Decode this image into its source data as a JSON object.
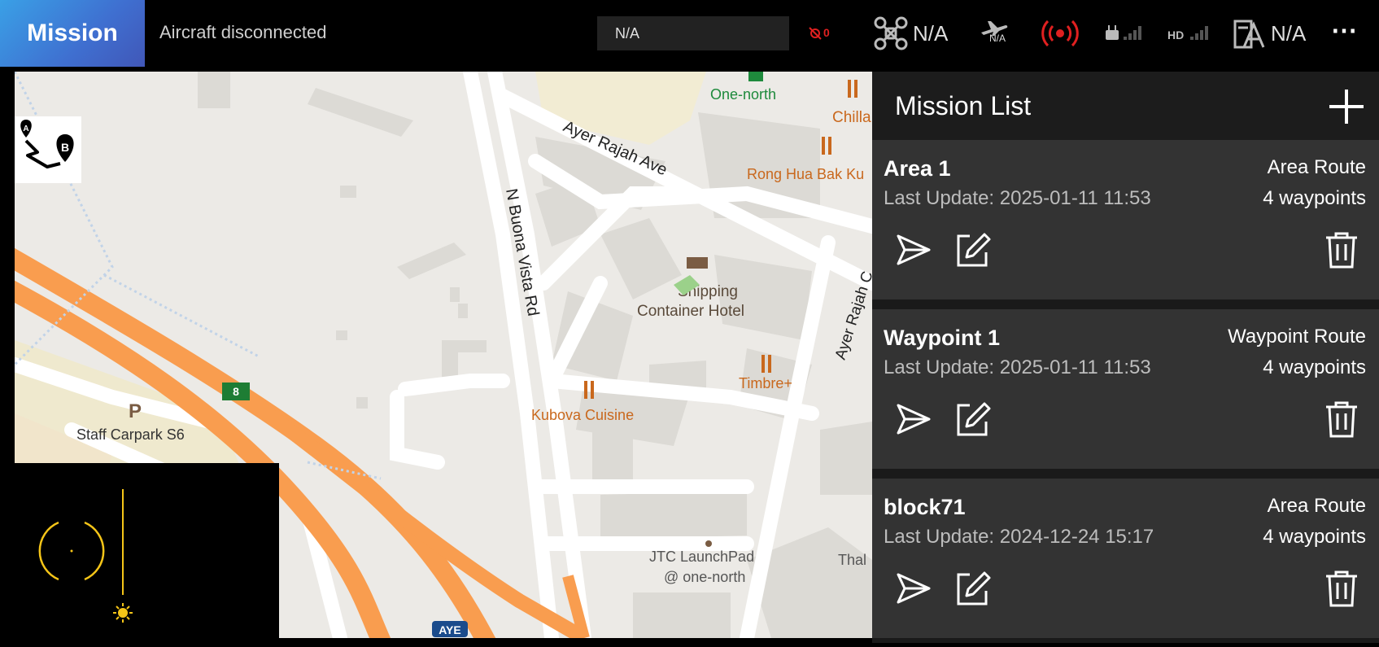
{
  "topbar": {
    "mission_label": "Mission",
    "status": "Aircraft disconnected",
    "field_value": "N/A",
    "alert_count": "0",
    "aircraft_value": "N/A",
    "flight_mode_value": "N/A",
    "gps_value": "N/A",
    "more_label": "⋯"
  },
  "panel": {
    "title": "Mission List",
    "missions": [
      {
        "name": "Area 1",
        "date": "Last Update: 2025-01-11 11:53",
        "type": "Area Route",
        "waypoints": "4 waypoints"
      },
      {
        "name": "Waypoint 1",
        "date": "Last Update: 2025-01-11 11:53",
        "type": "Waypoint Route",
        "waypoints": "4 waypoints"
      },
      {
        "name": "block71",
        "date": "Last Update: 2024-12-24 15:17",
        "type": "Area Route",
        "waypoints": "4 waypoints"
      }
    ]
  },
  "map": {
    "labels": {
      "one_north": "One-north",
      "ayer_rajah_ave": "Ayer Rajah Ave",
      "rong_hua": "Rong Hua Bak Ku",
      "chilla": "Chilla",
      "n_buona_vista": "N Buona Vista Rd",
      "shipping1": "Shipping",
      "shipping2": "Container Hotel",
      "ayer_rajah_c": "Ayer Rajah C",
      "timbre": "Timbre+",
      "kubova": "Kubova Cuisine",
      "staff_carpark": "Staff Carpark S6",
      "jtc1": "JTC LaunchPad",
      "jtc2": "@ one-north",
      "thal": "Thal",
      "aye": "AYE",
      "route_8": "8",
      "parking": "P",
      "ab_a": "A",
      "ab_b": "B"
    }
  },
  "colors": {
    "accent_gradient_start": "#3aa0e6",
    "accent_gradient_end": "#4157b8",
    "alert_red": "#e02020",
    "compass_yellow": "#f5c518",
    "highway_orange": "#f99d4f",
    "poi_orange": "#c9681d"
  }
}
